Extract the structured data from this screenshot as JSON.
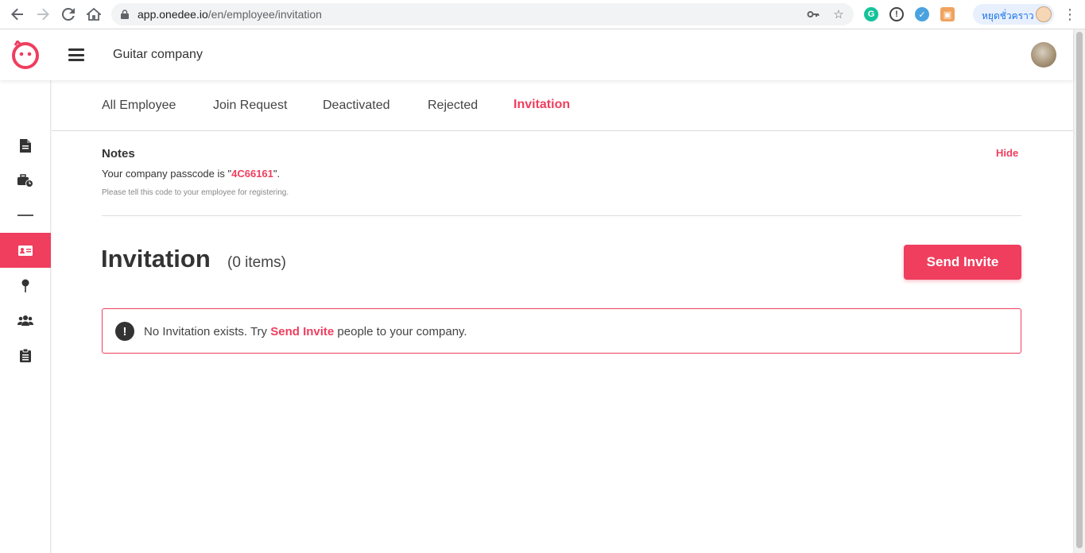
{
  "browser": {
    "url_host": "app.onedee.io",
    "url_path": "/en/employee/invitation",
    "profile_label": "หยุดชั่วคราว"
  },
  "header": {
    "company_name": "Guitar company"
  },
  "sidebar": {
    "items": [
      {
        "icon": "document-icon"
      },
      {
        "icon": "briefcase-clock-icon"
      },
      {
        "icon": "divider"
      },
      {
        "icon": "id-card-icon",
        "active": true
      },
      {
        "icon": "map-pin-icon"
      },
      {
        "icon": "users-icon"
      },
      {
        "icon": "clipboard-icon"
      }
    ]
  },
  "tabs": [
    {
      "label": "All Employee"
    },
    {
      "label": "Join Request"
    },
    {
      "label": "Deactivated"
    },
    {
      "label": "Rejected"
    },
    {
      "label": "Invitation",
      "active": true
    }
  ],
  "notes": {
    "title": "Notes",
    "hide_label": "Hide",
    "passcode_prefix": "Your company passcode is \"",
    "passcode": "4C66161",
    "passcode_suffix": "\".",
    "hint": "Please tell this code to your employee for registering."
  },
  "section": {
    "title": "Invitation",
    "count_label": "(0 items)",
    "send_invite_label": "Send Invite"
  },
  "alert": {
    "prefix": "No Invitation exists. Try ",
    "link_label": "Send Invite",
    "suffix": " people to your company."
  },
  "colors": {
    "accent": "#ef3e5e"
  }
}
